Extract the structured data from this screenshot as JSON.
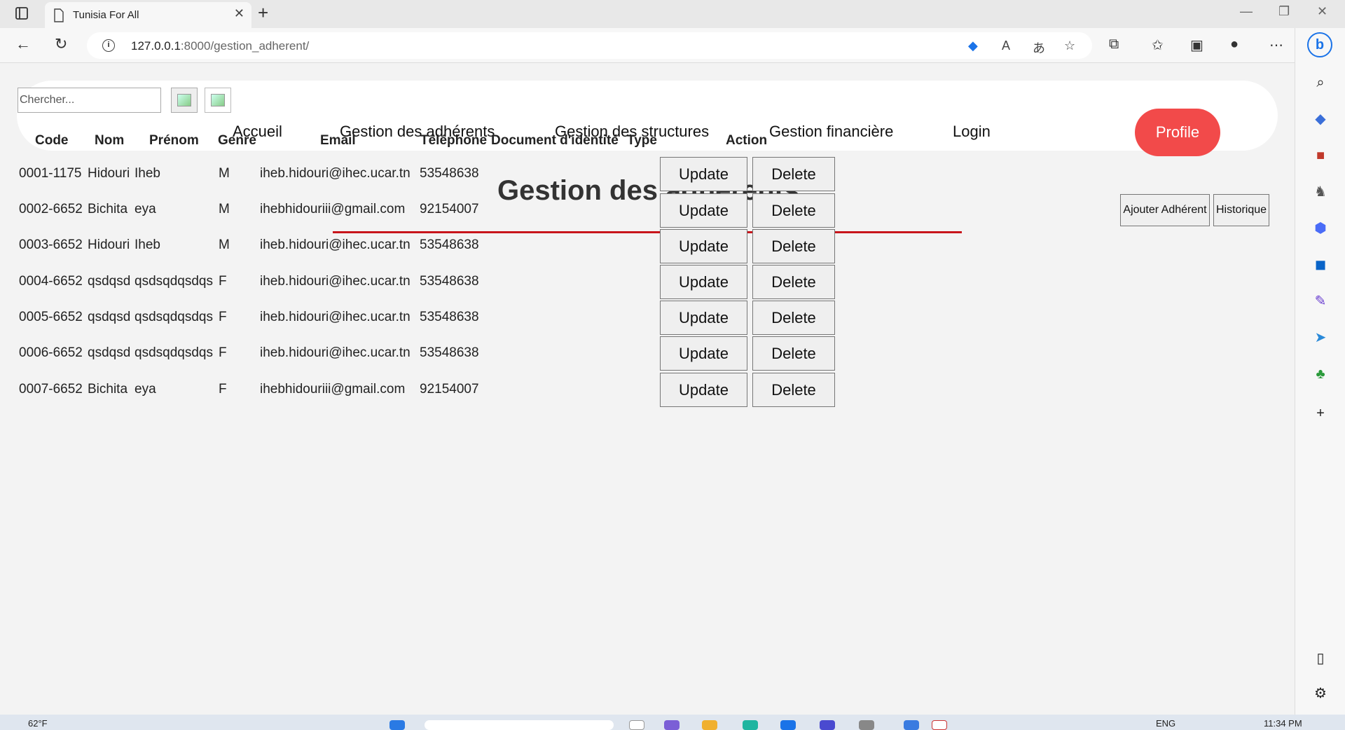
{
  "browser": {
    "tab_title": "Tunisia For All",
    "url_host": "127.0.0.1",
    "url_path": ":8000/gestion_adherent/"
  },
  "search": {
    "placeholder": "Chercher..."
  },
  "nav": {
    "items": [
      "Accueil",
      "Gestion des adhérents",
      "Gestion des structures",
      "Gestion financière",
      "Login"
    ],
    "profile": "Profile"
  },
  "page_title": "Gestion des adhérents",
  "table": {
    "headers": [
      "Code",
      "Nom",
      "Prénom",
      "Genre",
      "Email",
      "Téléphone",
      "Document d'identité",
      "Type",
      "Action"
    ],
    "rows": [
      {
        "code": "0001-1175",
        "nom": "Hidouri",
        "prenom": "Iheb",
        "genre": "M",
        "email": "iheb.hidouri@ihec.ucar.tn",
        "tel": "53548638"
      },
      {
        "code": "0002-6652",
        "nom": "Bichita",
        "prenom": "eya",
        "genre": "M",
        "email": "ihebhidouriii@gmail.com",
        "tel": "92154007"
      },
      {
        "code": "0003-6652",
        "nom": "Hidouri",
        "prenom": "Iheb",
        "genre": "M",
        "email": "iheb.hidouri@ihec.ucar.tn",
        "tel": "53548638"
      },
      {
        "code": "0004-6652",
        "nom": "qsdqsd",
        "prenom": "qsdsqdqsdqs",
        "genre": "F",
        "email": "iheb.hidouri@ihec.ucar.tn",
        "tel": "53548638"
      },
      {
        "code": "0005-6652",
        "nom": "qsdqsd",
        "prenom": "qsdsqdqsdqs",
        "genre": "F",
        "email": "iheb.hidouri@ihec.ucar.tn",
        "tel": "53548638"
      },
      {
        "code": "0006-6652",
        "nom": "qsdqsd",
        "prenom": "qsdsqdqsdqs",
        "genre": "F",
        "email": "iheb.hidouri@ihec.ucar.tn",
        "tel": "53548638"
      },
      {
        "code": "0007-6652",
        "nom": "Bichita",
        "prenom": "eya",
        "genre": "F",
        "email": "ihebhidouriii@gmail.com",
        "tel": "92154007"
      }
    ],
    "update_label": "Update",
    "delete_label": "Delete"
  },
  "actions": {
    "add_label": "Ajouter Adhérent",
    "history_label": "Historique"
  },
  "taskbar": {
    "weather": "62°F",
    "lang": "ENG",
    "time": "11:34 PM"
  },
  "colors": {
    "profile_button": "#f24a4a",
    "title_underline": "#c8151b"
  }
}
